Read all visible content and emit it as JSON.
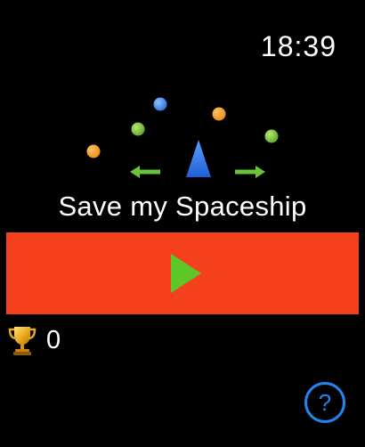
{
  "status_bar": {
    "time": "18:39"
  },
  "logo": {
    "description_icons": [
      "ball-icon",
      "spaceship-icon",
      "arrow-left-icon",
      "arrow-right-icon"
    ],
    "colors": {
      "ball_orange": "#f7931e",
      "ball_green": "#7ac143",
      "ball_blue": "#3a86e8",
      "spaceship_blue": "#2e6fe0",
      "arrow_green": "#6cc23a"
    }
  },
  "title": "Save my Spaceship",
  "play_button": {
    "icon": "play-icon",
    "background_color": "#f5401e",
    "icon_color": "#5ec728"
  },
  "score": {
    "icon": "trophy-icon",
    "value": "0"
  },
  "help_button": {
    "label": "?",
    "color": "#1e86f0"
  }
}
